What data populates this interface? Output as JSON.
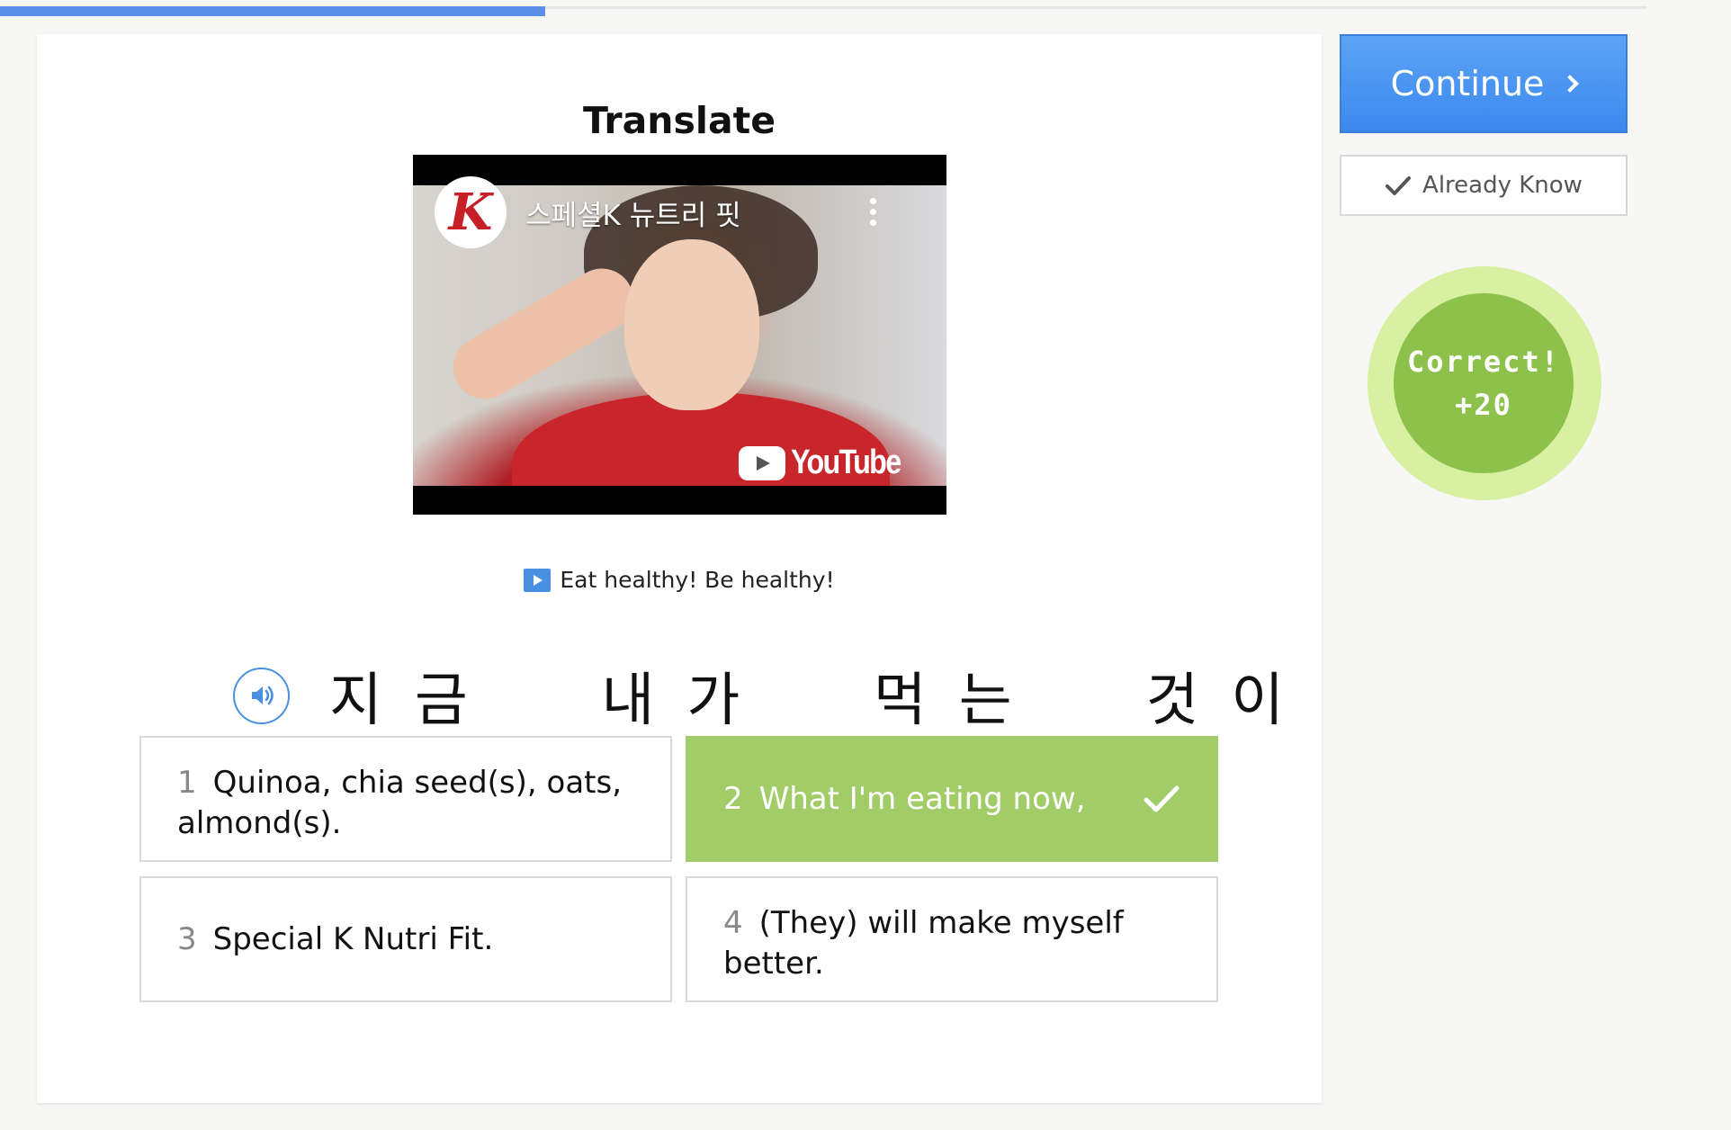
{
  "progress": {
    "percent": 31.5,
    "color": "#5b8ee6"
  },
  "exercise": {
    "title": "Translate",
    "video": {
      "channel_logo": "K",
      "title": "스페셜K 뉴트리 핏",
      "platform": "YouTube"
    },
    "caption": "Eat healthy! Be healthy!",
    "phrase": "지금  내가  먹는  것이",
    "options": [
      {
        "number": "1",
        "text": "Quinoa, chia seed(s), oats, almond(s).",
        "state": "default"
      },
      {
        "number": "2",
        "text": "What I'm eating now,",
        "state": "correct"
      },
      {
        "number": "3",
        "text": "Special K Nutri Fit.",
        "state": "default"
      },
      {
        "number": "4",
        "text": "(They) will make myself better.",
        "state": "default"
      }
    ]
  },
  "sidebar": {
    "continue_label": "Continue",
    "already_know_label": "Already Know",
    "result": {
      "line1": "Correct!",
      "line2": "+20"
    }
  },
  "colors": {
    "accent_blue": "#4a90e2",
    "correct_green": "#a1cc67",
    "badge_green": "#8dc14c",
    "badge_ring": "#d8f0a2"
  },
  "icons": {
    "speaker": "speaker-icon",
    "film": "film-icon",
    "check": "check-icon",
    "chevron": "chevron-right-icon"
  }
}
